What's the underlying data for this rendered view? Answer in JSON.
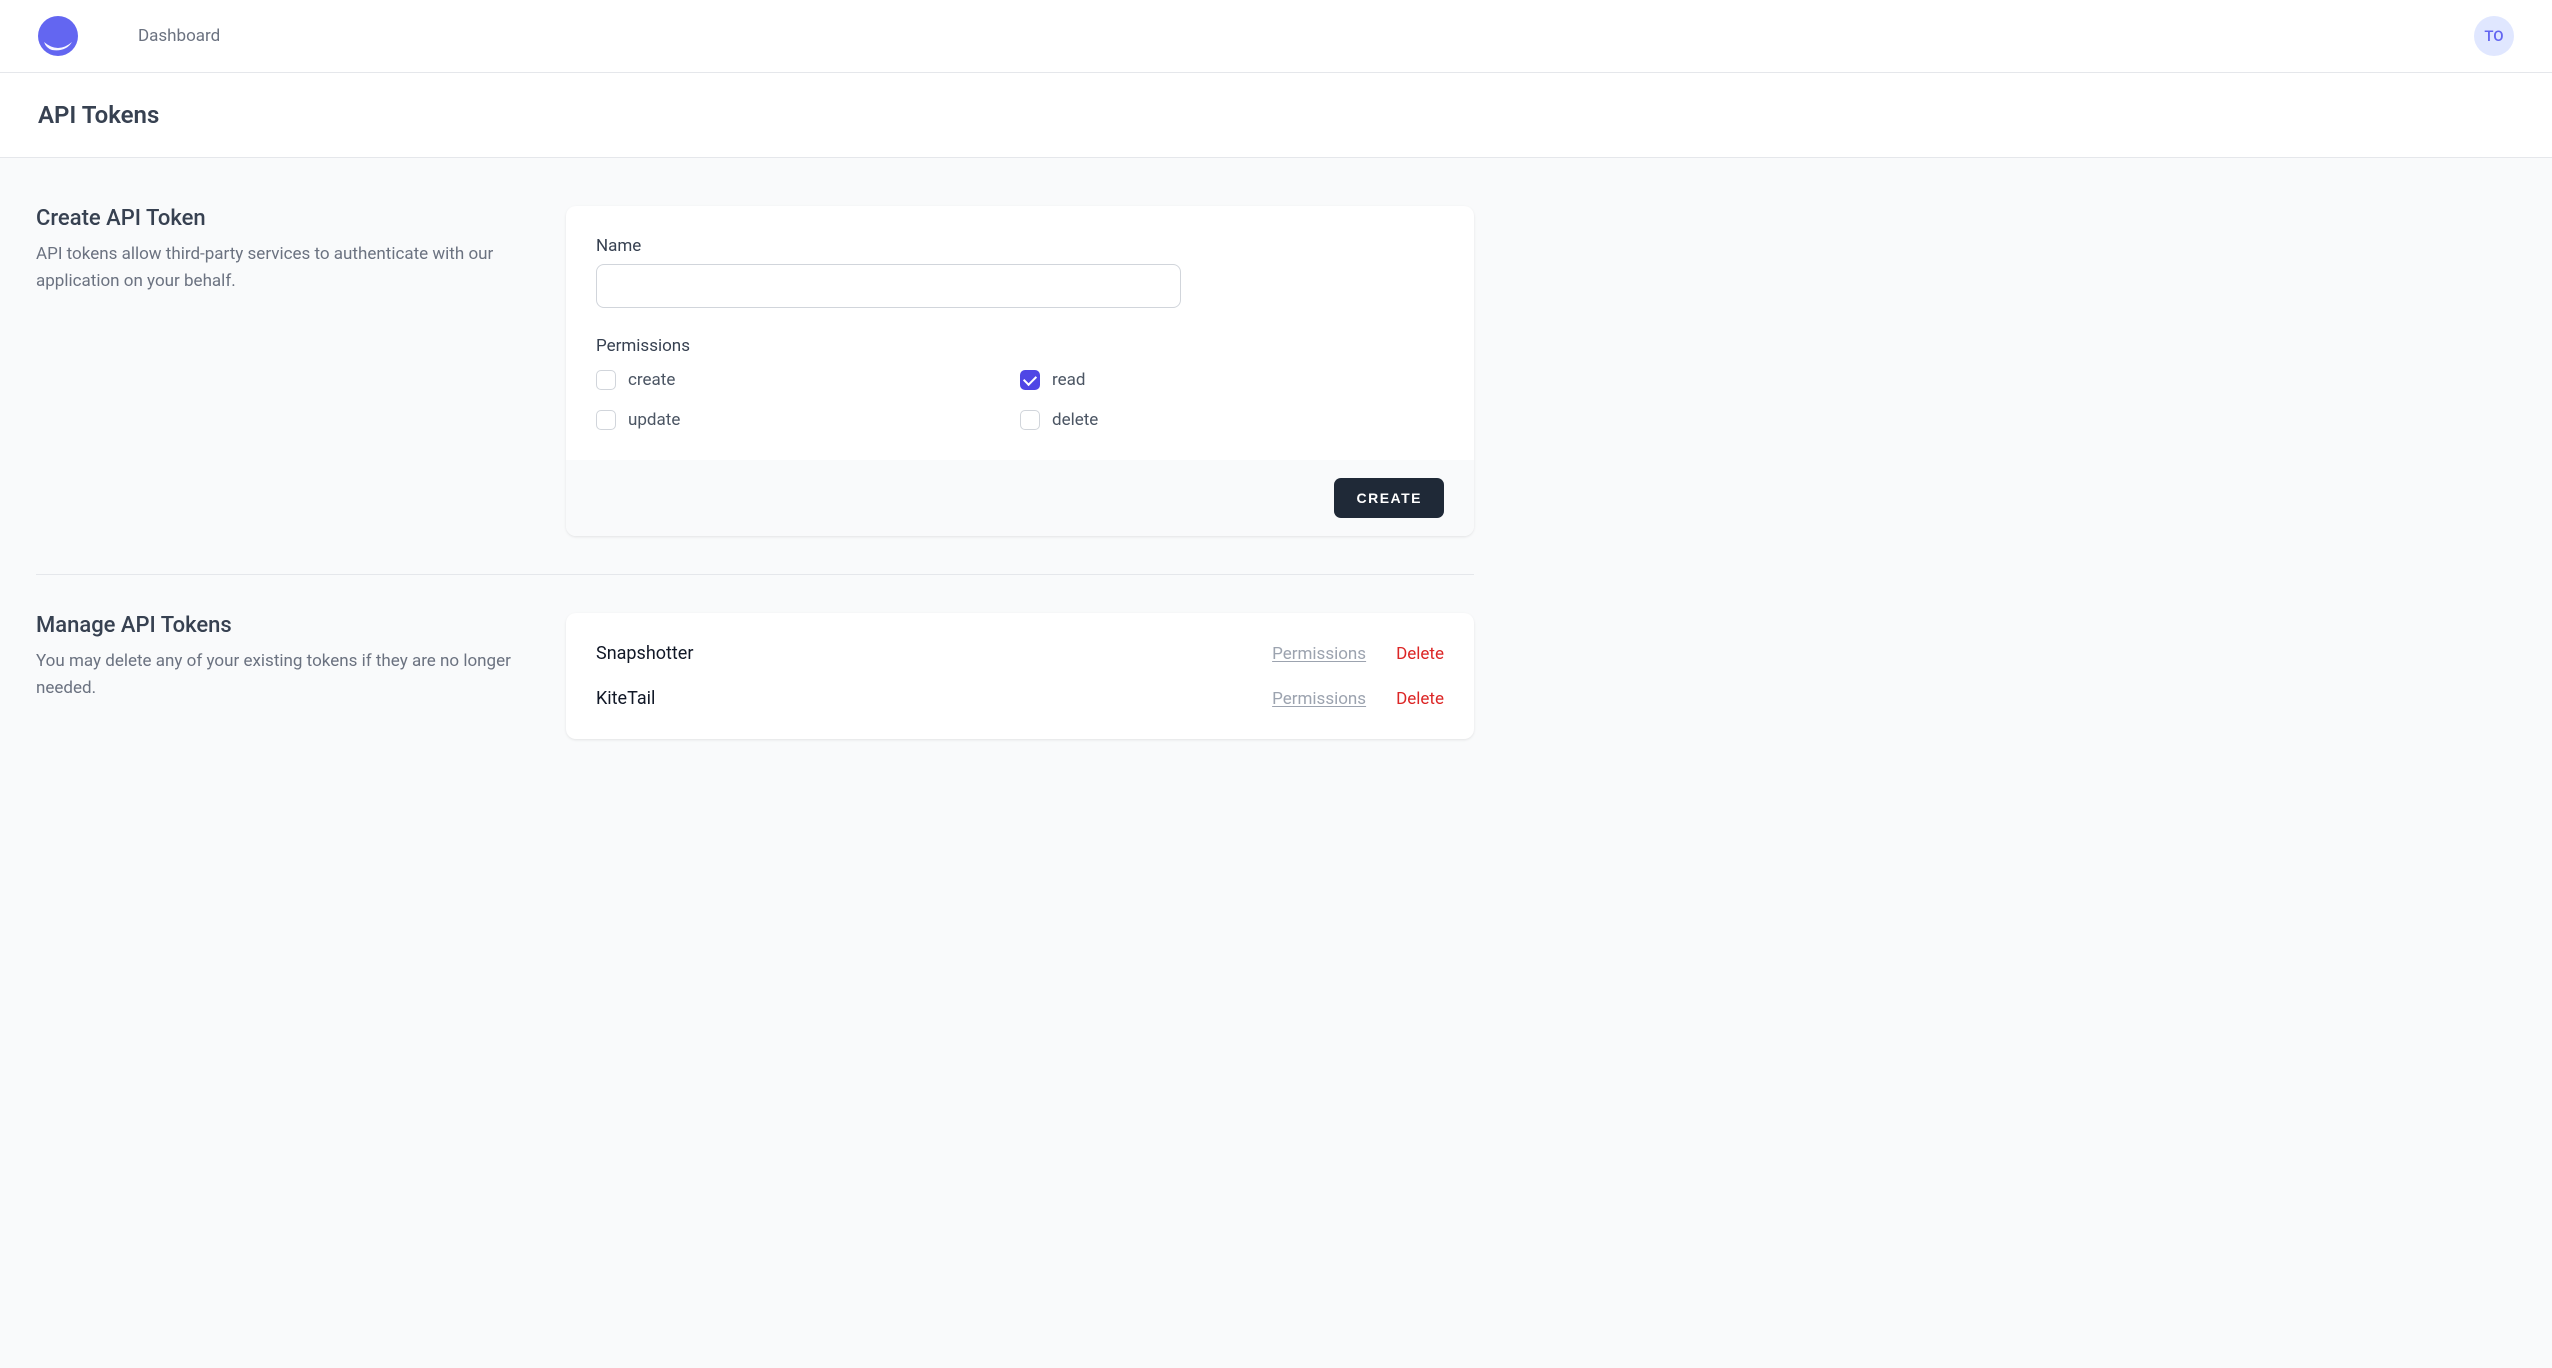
{
  "navbar": {
    "dashboard_label": "Dashboard",
    "avatar_initials": "TO"
  },
  "page": {
    "title": "API Tokens"
  },
  "create_section": {
    "title": "Create API Token",
    "description": "API tokens allow third-party services to authenticate with our application on your behalf.",
    "name_label": "Name",
    "name_value": "",
    "permissions_label": "Permissions",
    "permissions": [
      {
        "key": "create",
        "label": "create",
        "checked": false
      },
      {
        "key": "read",
        "label": "read",
        "checked": true
      },
      {
        "key": "update",
        "label": "update",
        "checked": false
      },
      {
        "key": "delete",
        "label": "delete",
        "checked": false
      }
    ],
    "submit_label": "Create"
  },
  "manage_section": {
    "title": "Manage API Tokens",
    "description": "You may delete any of your existing tokens if they are no longer needed.",
    "permissions_link": "Permissions",
    "delete_link": "Delete",
    "tokens": [
      {
        "name": "Snapshotter"
      },
      {
        "name": "KiteTail"
      }
    ]
  }
}
